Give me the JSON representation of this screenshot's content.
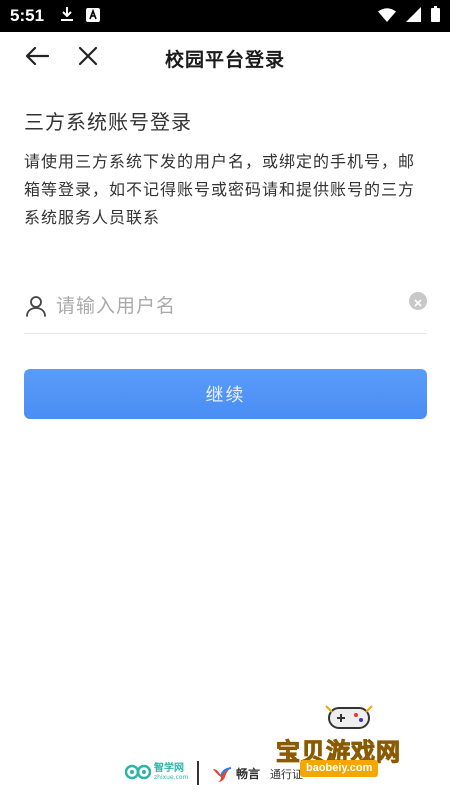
{
  "status_bar": {
    "time": "5:51"
  },
  "header": {
    "title": "校园平台登录"
  },
  "login": {
    "section_title": "三方系统账号登录",
    "description": "请使用三方系统下发的用户名，或绑定的手机号，邮箱等登录，如不记得账号或密码请和提供账号的三方系统服务人员联系",
    "username_placeholder": "请输入用户名",
    "continue_label": "继续"
  },
  "footer": {
    "zhixue_name": "智学网",
    "zhixue_domain": "zhixue.com",
    "changyan_name": "畅言",
    "changyan_tag": "通行证"
  },
  "watermark": {
    "title": "宝贝游戏网",
    "url": "baobeiy.com"
  },
  "colors": {
    "accent": "#4a8df5",
    "status_bar": "#000000"
  }
}
